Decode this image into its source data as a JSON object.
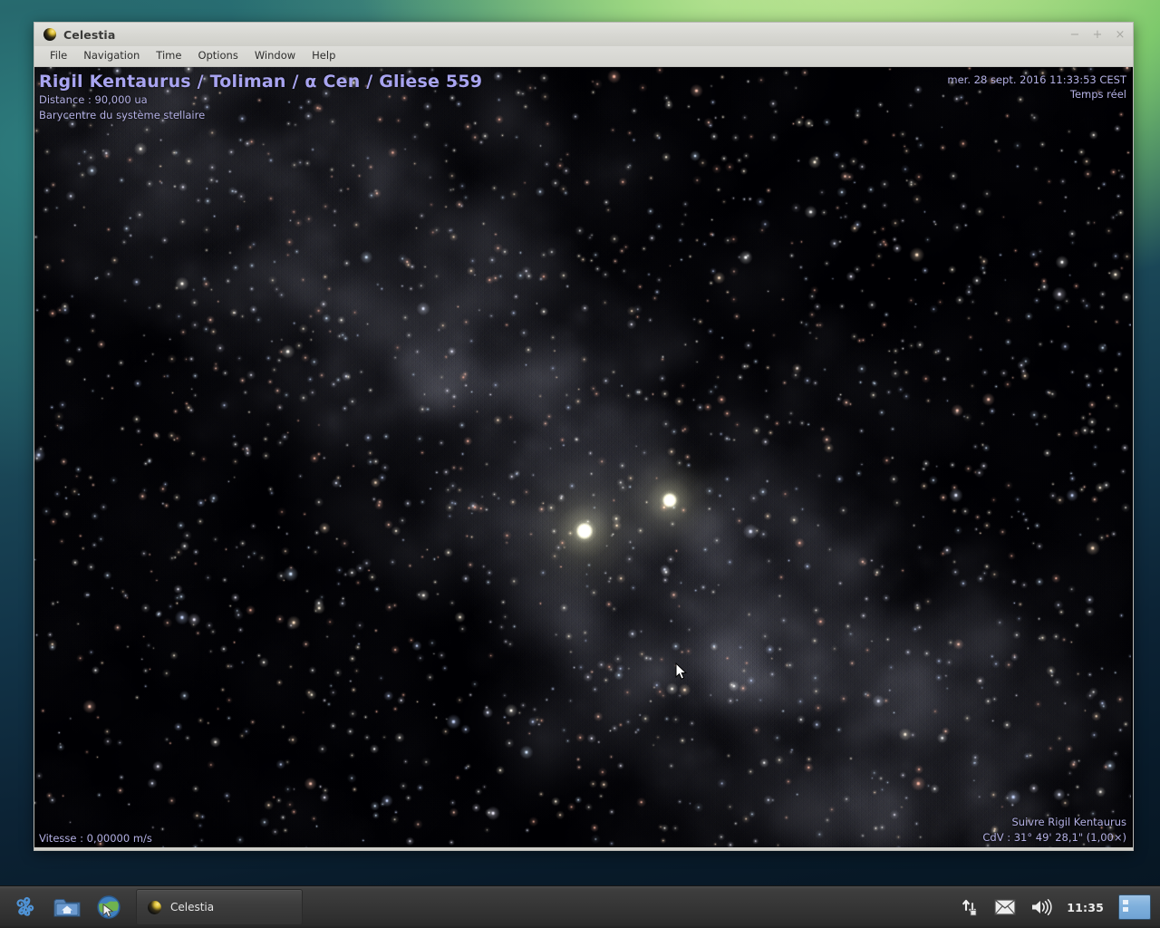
{
  "window": {
    "title": "Celestia",
    "icon": "celestia-sphere-icon",
    "buttons": {
      "minimize": "−",
      "maximize": "+",
      "close": "×"
    },
    "menu": [
      "File",
      "Navigation",
      "Time",
      "Options",
      "Window",
      "Help"
    ]
  },
  "overlay": {
    "object_name": "Rigil Kentaurus / Toliman / α Cen / Gliese 559",
    "distance": "Distance : 90,000 ua",
    "subtitle": "Barycentre du système stellaire",
    "datetime": "mer. 28 sept. 2016 11:33:53 CEST",
    "time_mode": "Temps réel",
    "speed": "Vitesse : 0,00000 m/s",
    "follow": "Suivre Rigil Kentaurus",
    "fov": "CdV : 31° 49' 28,1\" (1,00×)"
  },
  "taskbar": {
    "launchers": [
      {
        "name": "triskelion-menu-icon",
        "label": ""
      },
      {
        "name": "home-folder-icon",
        "label": ""
      },
      {
        "name": "web-browser-globe-icon",
        "label": ""
      }
    ],
    "tasks": [
      {
        "label": "Celestia",
        "icon": "celestia-sphere-icon",
        "active": true
      }
    ],
    "tray": {
      "network_icon": "network-updown-arrows-icon",
      "mail_icon": "mail-envelope-icon",
      "volume_icon": "speaker-volume-icon",
      "clock": "11:35",
      "pager_icon": "workspace-switcher-icon"
    }
  },
  "colors": {
    "overlay_text": "#b3b0e4",
    "overlay_title": "#a8a4f0",
    "titlebar": "#d9d9d5",
    "taskbar": "#353535",
    "desktop_top": "#a9dc82",
    "desktop_bottom": "#061521",
    "star_a": "#f6f2cb",
    "star_b": "#f2edc0"
  },
  "scene": {
    "type": "3d-starfield",
    "stars_visible": "Alpha Centauri A and B",
    "background": "Milky Way diffuse nebulosity band running from upper-left to lower-right"
  }
}
